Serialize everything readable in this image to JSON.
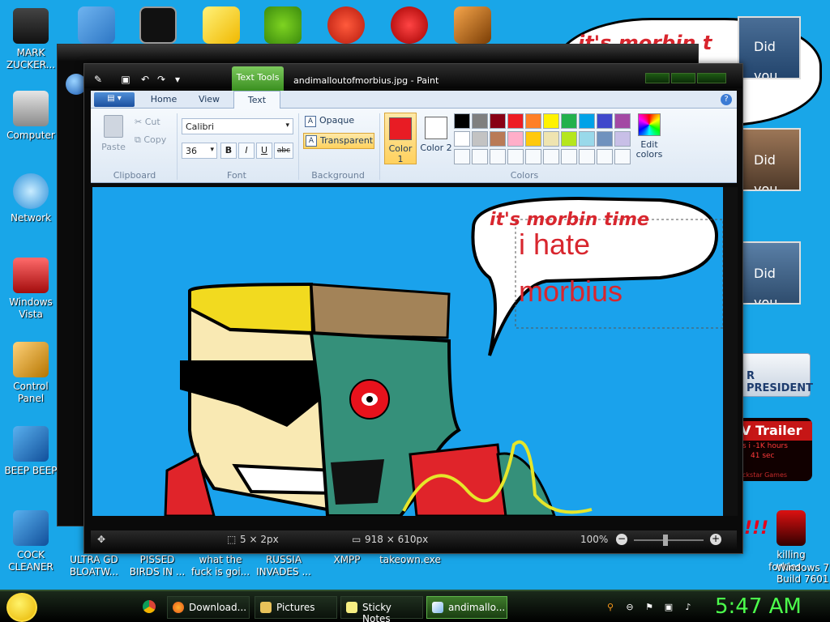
{
  "desktop": {
    "left_icons": [
      {
        "label": "MARK ZUCKER...",
        "icon": "person-icon"
      },
      {
        "label": "Computer",
        "icon": "computer-icon"
      },
      {
        "label": "Network",
        "icon": "network-icon"
      },
      {
        "label": "Windows Vista",
        "icon": "recycle-bin-icon"
      },
      {
        "label": "Control Panel",
        "icon": "control-panel-icon"
      },
      {
        "label": "BEEP BEEP",
        "icon": "file-icon"
      },
      {
        "label": "COCK CLEANER",
        "icon": "file-icon"
      }
    ],
    "bottom_icons": [
      "ULTRA GD BLOATW...",
      "PISSED BIRDS IN ...",
      "what the fuck is goi...",
      "RUSSIA INVADES ...",
      "XMPP",
      "takeown.exe"
    ],
    "right_icon": {
      "label": "killing forkles ...",
      "icon": "game-icon"
    },
    "watermark_lines": [
      "Windows 7",
      "Build 7601"
    ],
    "gadgets": {
      "speech_top": "it's morbin t",
      "vote_cards": [
        "Did you Vote?",
        "Did you Vote?",
        "Did you Vote?"
      ],
      "president_button": "R PRESIDENT",
      "trailer_title": "V Trailer",
      "trailer_sub": "s i -1K hours",
      "trailer_sub2": "41 sec",
      "trailer_studio": "ckstar Games"
    }
  },
  "paint": {
    "title": "andimalloutofmorbius.jpg - Paint",
    "context_tab": "Text Tools",
    "tabs": [
      "Home",
      "View",
      "Text"
    ],
    "active_tab": "Text",
    "file_menu_icon": "file-menu-icon",
    "clipboard": {
      "paste": "Paste",
      "cut": "Cut",
      "copy": "Copy",
      "label": "Clipboard"
    },
    "font": {
      "family": "Calibri",
      "size": "36",
      "bold": "B",
      "italic": "I",
      "underline": "U",
      "strike": "abc",
      "label": "Font"
    },
    "background": {
      "opaque": "Opaque",
      "transparent": "Transparent",
      "label": "Background"
    },
    "colors": {
      "color1_label": "Color 1",
      "color2_label": "Color 2",
      "color1": "#e81c24",
      "color2": "#ffffff",
      "edit_label": "Edit colors",
      "label": "Colors",
      "palette_row1": [
        "#000000",
        "#7f7f7f",
        "#880015",
        "#ed1c24",
        "#ff7f27",
        "#fff200",
        "#22b14c",
        "#00a2e8",
        "#3f48cc",
        "#a349a4"
      ],
      "palette_row2": [
        "#ffffff",
        "#c3c3c3",
        "#b97a57",
        "#ffaec9",
        "#ffc90e",
        "#efe4b0",
        "#b5e61d",
        "#99d9ea",
        "#7092be",
        "#c8bfe7"
      ]
    },
    "canvas": {
      "speech_text": "it's morbin time",
      "typed_line1": "i hate",
      "typed_line2": "morbius"
    },
    "status": {
      "selection": "5 × 2px",
      "image_size": "918 × 610px",
      "zoom": "100%"
    }
  },
  "taskbar": {
    "buttons": [
      {
        "label": "Download...",
        "icon": "firefox-icon"
      },
      {
        "label": "Pictures",
        "icon": "folder-icon"
      },
      {
        "label": "Sticky Notes",
        "icon": "sticky-notes-icon"
      },
      {
        "label": "andimallo...",
        "icon": "paint-icon"
      }
    ],
    "time": "5:47 AM"
  }
}
